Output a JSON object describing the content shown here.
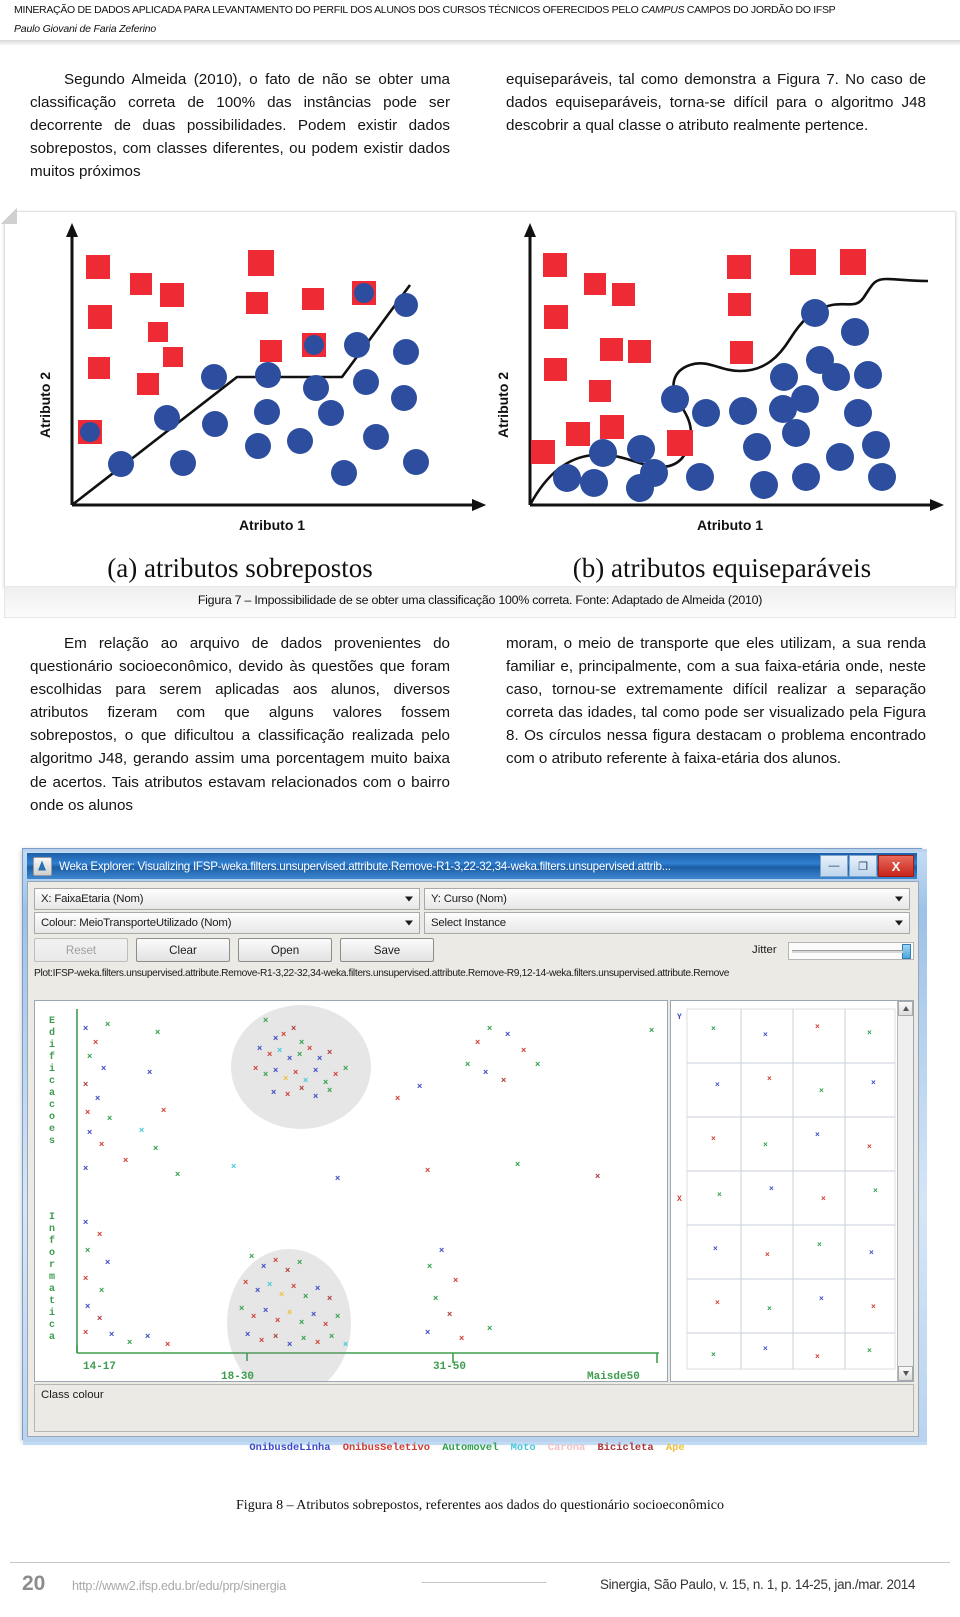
{
  "running_head": {
    "title_pre": "MINERAÇÃO DE DADOS APLICADA PARA LEVANTAMENTO DO PERFIL DOS ALUNOS DOS CURSOS TÉCNICOS OFERECIDOS PELO ",
    "title_italic": "CAMPUS",
    "title_post": " CAMPOS DO JORDÃO DO IFSP",
    "author": "Paulo Giovani de Faria Zeferino"
  },
  "body": {
    "left_top": "Segundo Almeida (2010), o fato de não se obter uma classificação correta de 100% das instâncias pode ser decorrente de duas possibilidades. Podem existir dados sobrepostos, com classes diferentes, ou podem existir dados muitos próximos",
    "right_top": "equiseparáveis, tal como demonstra a Figura 7. No caso de dados equiseparáveis, torna-se difícil para o algoritmo J48 descobrir a qual classe o atributo realmente pertence.",
    "left_bottom": "Em relação ao arquivo de dados provenientes do questionário socioeconômico, devido às questões que foram escolhidas para serem aplicadas aos alunos, diversos atributos fizeram com que alguns valores fossem sobrepostos, o que dificultou a classificação realizada pelo algoritmo J48, gerando assim uma porcentagem muito baixa de acertos. Tais atributos estavam relacionados com o bairro onde os alunos",
    "right_bottom": "moram, o meio de transporte que eles utilizam, a sua renda familiar e, principalmente, com a sua faixa-etária onde, neste caso, tornou-se extremamente difícil realizar a separação correta das idades, tal como pode ser visualizado pela Figura 8. Os círculos nessa figura destacam o problema encontrado com o atributo referente à faixa-etária dos alunos."
  },
  "figure7": {
    "caption": "Figura 7 – Impossibilidade de se obter uma classificação 100% correta. Fonte: Adaptado de Almeida (2010)",
    "panel_a_label": "(a) atributos sobrepostos",
    "panel_b_label": "(b) atributos equiseparáveis",
    "x_axis_label": "Atributo 1",
    "y_axis_label": "Atributo 2",
    "square_color": "#ee2a35",
    "circle_color": "#2d4e9e"
  },
  "weka": {
    "title": "Weka Explorer: Visualizing IFSP-weka.filters.unsupervised.attribute.Remove-R1-3,22-32,34-weka.filters.unsupervised.attrib...",
    "window_buttons": {
      "minimize": "—",
      "maximize": "❐",
      "close": "X"
    },
    "x_combo": "X: FaixaEtaria (Nom)",
    "y_combo": "Y: Curso (Nom)",
    "colour_combo": "Colour: MeioTransporteUtilizado (Nom)",
    "select_instance_combo": "Select Instance",
    "buttons": {
      "reset": "Reset",
      "clear": "Clear",
      "open": "Open",
      "save": "Save"
    },
    "jitter_label": "Jitter",
    "plot_line": "Plot:IFSP-weka.filters.unsupervised.attribute.Remove-R1-3,22-32,34-weka.filters.unsupervised.attribute.Remove-R9,12-14-weka.filters.unsupervised.attribute.Remove",
    "y_axis_vertical_label": "Edificacoes",
    "y_axis_vertical_label2": "Informatica",
    "x_tick_labels": [
      "14-17",
      "18-30",
      "31-50",
      "Maisde50"
    ],
    "side_panel_y_label": "Y",
    "side_panel_x_label": "X",
    "class_colour_label": "Class colour",
    "legend": [
      {
        "label": "OnibusdeLinha",
        "color": "#3b49c8"
      },
      {
        "label": "OnibusSeletivo",
        "color": "#d23b2e"
      },
      {
        "label": "Automovel",
        "color": "#2ea04a"
      },
      {
        "label": "Moto",
        "color": "#44c8da"
      },
      {
        "label": "Carona",
        "color": "#f2c0c4"
      },
      {
        "label": "Bicicleta",
        "color": "#b03636"
      },
      {
        "label": "Ape",
        "color": "#f0bf3e"
      }
    ]
  },
  "figure8": {
    "caption": "Figura 8 – Atributos sobrepostos, referentes aos dados do questionário socioeconômico"
  },
  "footer": {
    "page_number": "20",
    "url": "http://www2.ifsp.edu.br/edu/prp/sinergia",
    "citation": "Sinergia, São Paulo, v. 15, n. 1, p. 14-25, jan./mar. 2014"
  },
  "chart_data": {
    "type": "scatter",
    "title": "Impossibilidade de se obter uma classificação 100% correta",
    "xlabel": "Atributo 1",
    "ylabel": "Atributo 2",
    "panels": [
      {
        "name": "(a) atributos sobrepostos",
        "boundary": "piecewise-linear",
        "series": [
          {
            "name": "classe quadrado (vermelho)",
            "marker": "square",
            "color": "#ee2a35",
            "points": [
              [
                12,
                88
              ],
              [
                23,
                79
              ],
              [
                34,
                72
              ],
              [
                12,
                68
              ],
              [
                28,
                63
              ],
              [
                34,
                50
              ],
              [
                18,
                46
              ],
              [
                25,
                38
              ],
              [
                52,
                87
              ],
              [
                52,
                72
              ],
              [
                57,
                55
              ],
              [
                68,
                74
              ],
              [
                68,
                57
              ],
              [
                80,
                76
              ],
              [
                10,
                22
              ]
            ]
          },
          {
            "name": "classe círculo (azul)",
            "marker": "circle",
            "color": "#2d4e9e",
            "points": [
              [
                36,
                43
              ],
              [
                55,
                44
              ],
              [
                88,
                68
              ],
              [
                68,
                39
              ],
              [
                80,
                48
              ],
              [
                57,
                30
              ],
              [
                92,
                53
              ],
              [
                36,
                28
              ],
              [
                45,
                31
              ],
              [
                70,
                29
              ],
              [
                92,
                36
              ],
              [
                55,
                20
              ],
              [
                64,
                23
              ],
              [
                22,
                16
              ],
              [
                38,
                16
              ],
              [
                78,
                12
              ],
              [
                92,
                20
              ],
              [
                80,
                58
              ],
              [
                57,
                56
              ]
            ]
          }
        ]
      },
      {
        "name": "(b) atributos equiseparáveis",
        "boundary": "curved",
        "series": [
          {
            "name": "classe quadrado (vermelho)",
            "marker": "square",
            "color": "#ee2a35",
            "points": [
              [
                11,
                88
              ],
              [
                23,
                80
              ],
              [
                33,
                75
              ],
              [
                11,
                70
              ],
              [
                25,
                58
              ],
              [
                33,
                57
              ],
              [
                11,
                52
              ],
              [
                22,
                45
              ],
              [
                48,
                82
              ],
              [
                48,
                57
              ],
              [
                66,
                76
              ],
              [
                70,
                86
              ],
              [
                82,
                86
              ],
              [
                16,
                25
              ],
              [
                28,
                30
              ],
              [
                22,
                18
              ],
              [
                41,
                22
              ]
            ]
          },
          {
            "name": "classe círculo (azul)",
            "marker": "circle",
            "color": "#2d4e9e",
            "points": [
              [
                70,
                76
              ],
              [
                80,
                66
              ],
              [
                70,
                58
              ],
              [
                60,
                52
              ],
              [
                74,
                47
              ],
              [
                86,
                55
              ],
              [
                36,
                48
              ],
              [
                44,
                42
              ],
              [
                56,
                43
              ],
              [
                62,
                42
              ],
              [
                66,
                33
              ],
              [
                50,
                17
              ],
              [
                58,
                24
              ],
              [
                36,
                22
              ],
              [
                30,
                27
              ],
              [
                24,
                12
              ],
              [
                34,
                12
              ],
              [
                46,
                12
              ],
              [
                66,
                12
              ],
              [
                74,
                22
              ],
              [
                82,
                40
              ],
              [
                86,
                22
              ],
              [
                90,
                13
              ],
              [
                62,
                30
              ]
            ]
          }
        ]
      }
    ]
  }
}
